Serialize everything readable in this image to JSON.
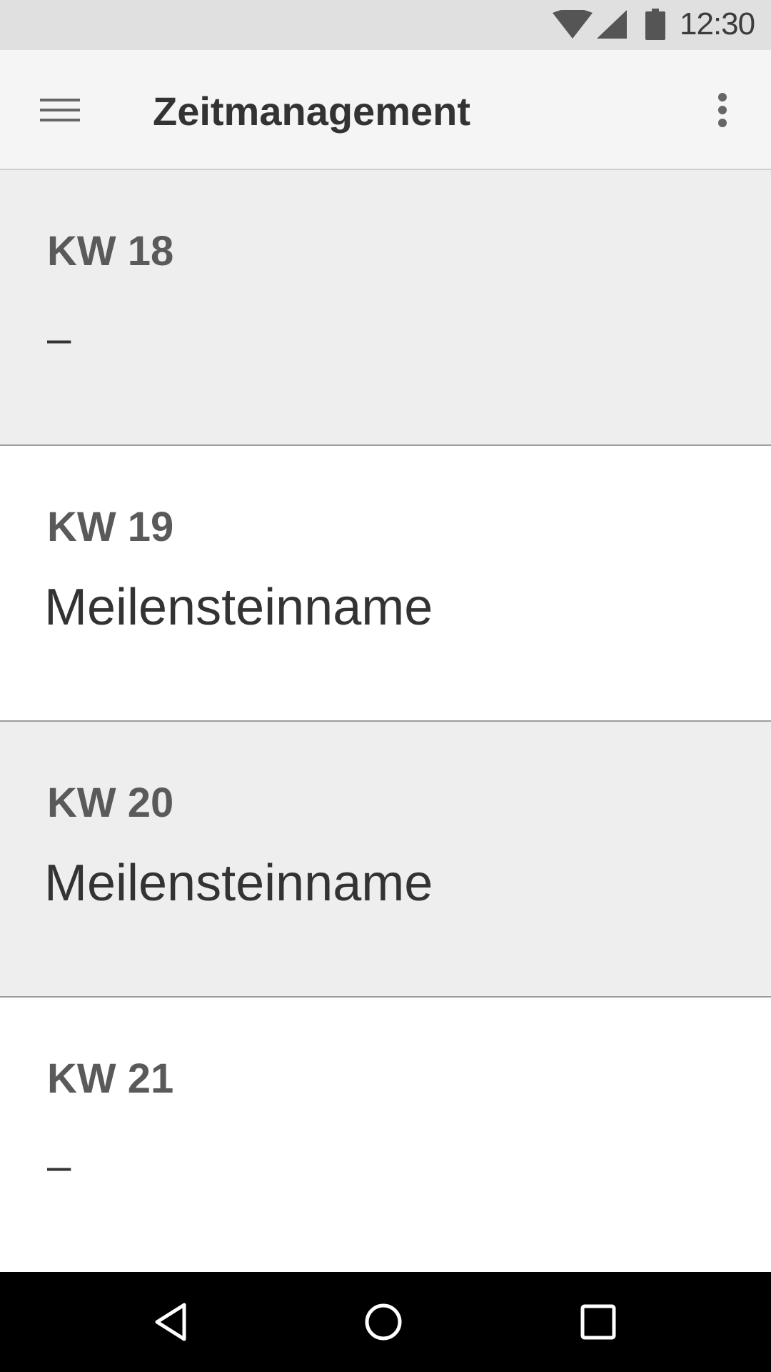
{
  "status_bar": {
    "time": "12:30",
    "icons": [
      "wifi-icon",
      "cell-signal-icon",
      "battery-icon"
    ]
  },
  "app_bar": {
    "title": "Zeitmanagement",
    "menu_icon": "hamburger-menu-icon",
    "overflow_icon": "more-vert-icon"
  },
  "weeks": [
    {
      "label": "KW 18",
      "milestone": "–"
    },
    {
      "label": "KW 19",
      "milestone": "Meilensteinname"
    },
    {
      "label": "KW 20",
      "milestone": "Meilensteinname"
    },
    {
      "label": "KW 21",
      "milestone": "–"
    }
  ],
  "nav_bar": {
    "icons": [
      "back-icon",
      "home-icon",
      "recents-icon"
    ]
  },
  "colors": {
    "status_bar": "#e0e0e0",
    "app_bar": "#f5f5f5",
    "row_shaded": "#eeeeee",
    "row_plain": "#ffffff",
    "nav_bar": "#000000"
  }
}
